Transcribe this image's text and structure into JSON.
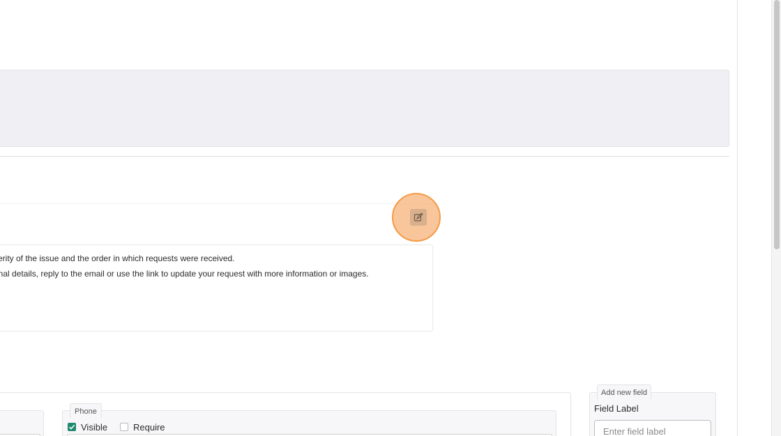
{
  "message": {
    "lines": [
      "verity of the issue and the order in which requests were received.",
      "onal details, reply to the email or use the link to update your request with more information or images."
    ]
  },
  "fields": {
    "phone": {
      "tab_label": "Phone",
      "visible_label": "Visible",
      "visible_checked": true,
      "require_label": "Require",
      "require_checked": false
    }
  },
  "add_new_field": {
    "tab_label": "Add new field",
    "field_label": "Field Label",
    "placeholder": "Enter field label"
  },
  "icons": {
    "edit": "edit-icon"
  },
  "colors": {
    "highlight": "#f59a45",
    "checkbox_checked": "#1f8a70",
    "panel_grey": "#f0f0f4"
  }
}
